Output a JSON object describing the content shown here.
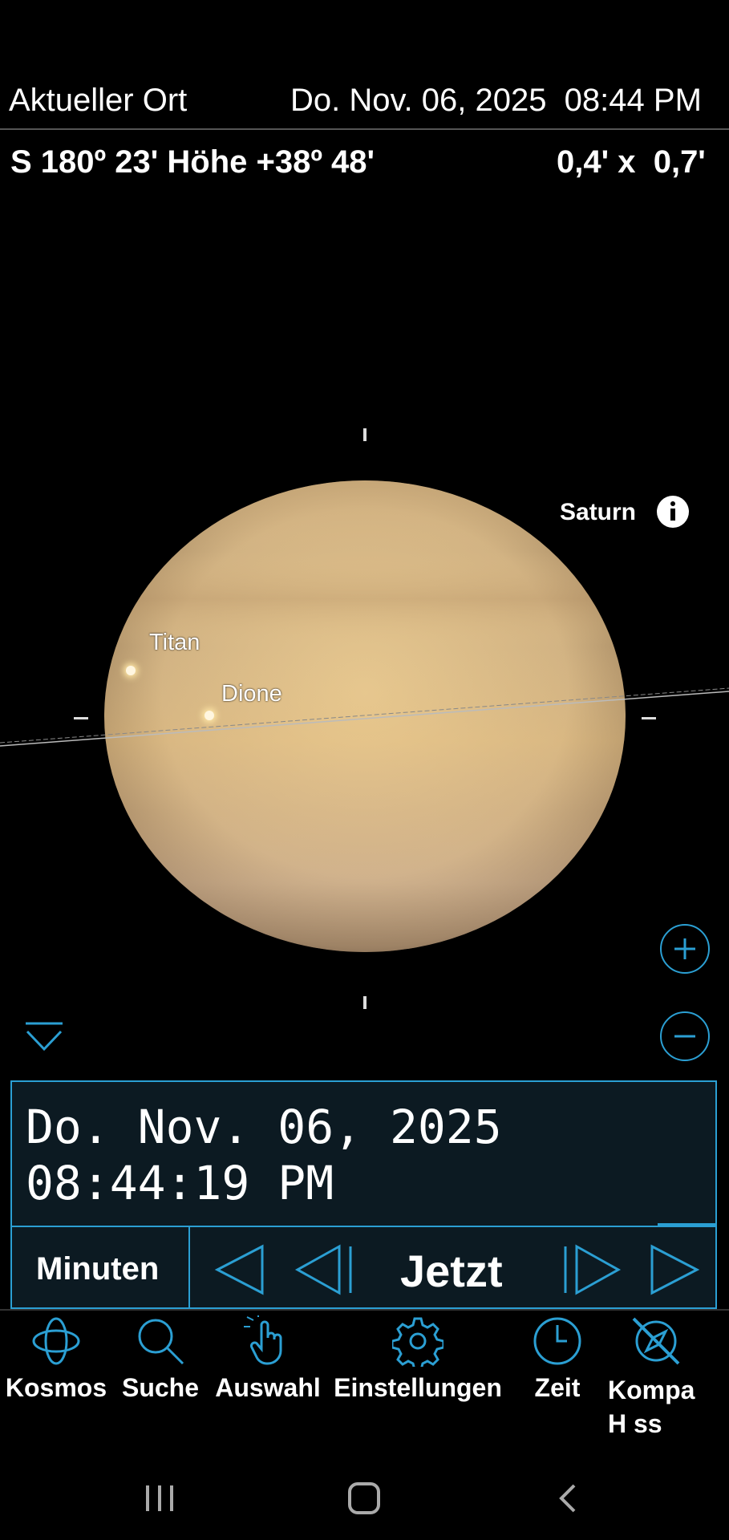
{
  "header": {
    "location": "Aktueller Ort",
    "datetime": "Do. Nov. 06, 2025  08:44 PM",
    "coords": "S  180º 23' Höhe +38º 48'",
    "size": "0,4' x  0,7'"
  },
  "sky": {
    "object_label": "Saturn",
    "moons": [
      {
        "name": "Titan"
      },
      {
        "name": "Dione"
      }
    ],
    "icons": {
      "info": "info-icon",
      "zoom_in": "plus-circle-icon",
      "zoom_out": "minus-circle-icon",
      "collapse": "chevron-down-icon"
    }
  },
  "time_panel": {
    "date": "Do. Nov. 06, 2025",
    "time": "08:44:19 PM",
    "step_unit": "Minuten",
    "now_label": "Jetzt",
    "icons": [
      "fast-back-icon",
      "step-back-icon",
      "step-forward-icon",
      "fast-forward-icon"
    ]
  },
  "bottom_nav": {
    "items": [
      {
        "label": "Kosmos",
        "icon": "orbit-icon"
      },
      {
        "label": "Suche",
        "icon": "search-icon"
      },
      {
        "label": "Auswahl",
        "icon": "hand-pointer-icon"
      },
      {
        "label": "Einstellungen",
        "icon": "gear-icon"
      },
      {
        "label": "Zeit",
        "icon": "clock-icon"
      },
      {
        "label": "Kompa H ss",
        "icon": "compass-disabled-icon"
      }
    ]
  },
  "colors": {
    "accent": "#2b9fd3",
    "background": "#000000",
    "panel": "#0c1a22"
  }
}
